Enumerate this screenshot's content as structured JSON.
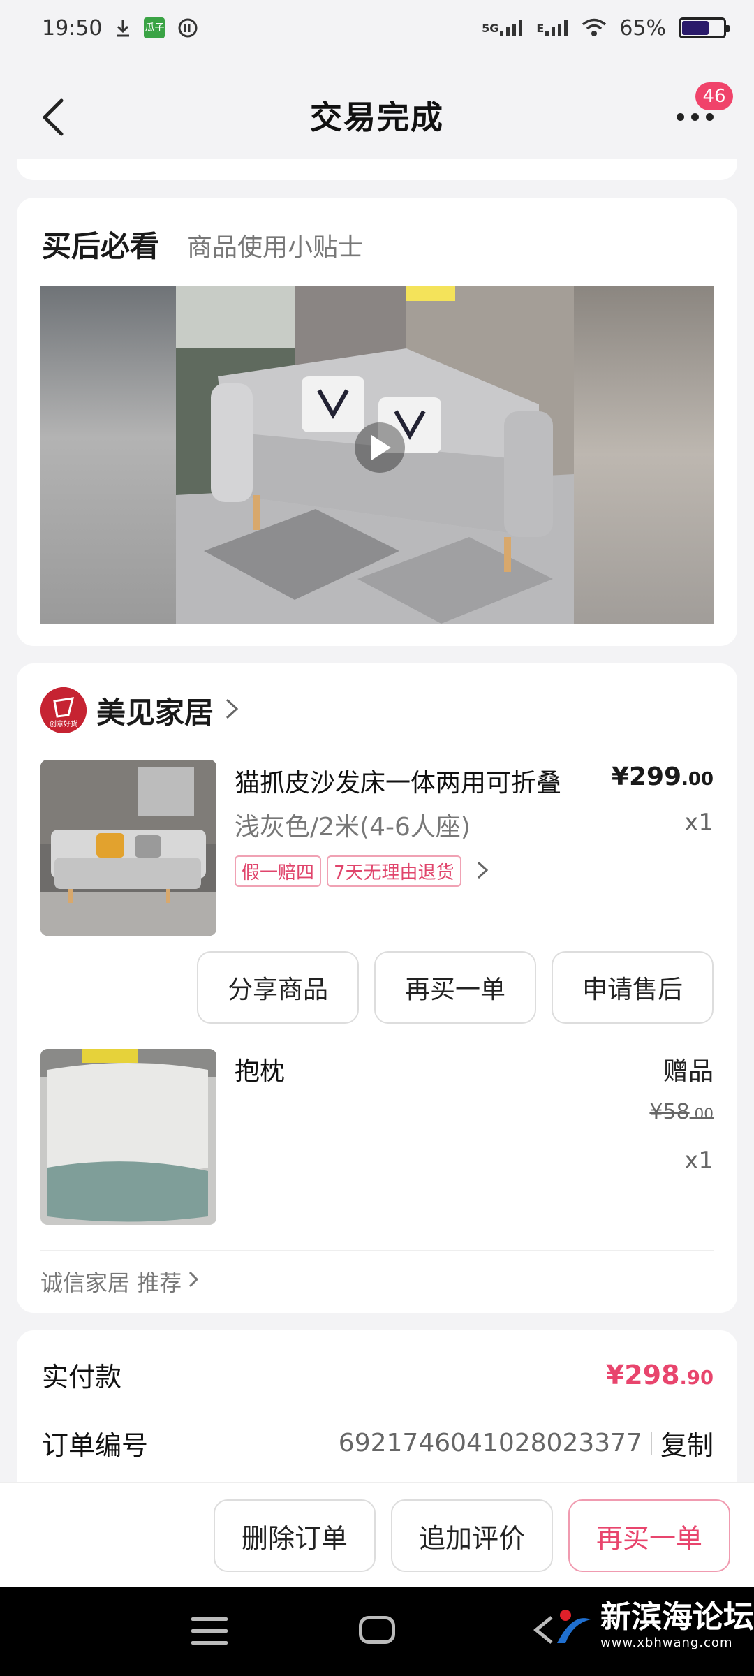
{
  "status_bar": {
    "time": "19:50",
    "app_icon_text": "瓜子",
    "network": "5G",
    "network2": "E",
    "battery": "65%",
    "battery_level": 0.65
  },
  "header": {
    "title": "交易完成",
    "badge": "46"
  },
  "tips": {
    "title": "买后必看",
    "subtitle": "商品使用小贴士"
  },
  "shop": {
    "logo_text": "创意好货",
    "name": "美见家居",
    "item1": {
      "title": "猫抓皮沙发床一体两用可折叠",
      "price_int": "¥299",
      "price_dec": ".00",
      "spec": "浅灰色/2米(4-6人座)",
      "qty": "x1",
      "tags": [
        "假一赔四",
        "7天无理由退货"
      ]
    },
    "item_buttons": [
      "分享商品",
      "再买一单",
      "申请售后"
    ],
    "item2": {
      "title": "抱枕",
      "gift_label": "赠品",
      "price_int": "¥58",
      "price_dec": ".00",
      "qty": "x1"
    },
    "recommend": "诚信家居 推荐"
  },
  "payment": {
    "paid_label": "实付款",
    "paid_int": "¥298",
    "paid_dec": ".90",
    "order_label": "订单编号",
    "order_no": "6921746041028023377",
    "copy": "复制"
  },
  "bottom_actions": {
    "delete": "删除订单",
    "review": "追加评价",
    "rebuy": "再买一单"
  },
  "watermark": {
    "name": "新滨海论坛",
    "url": "www.xbhwang.com"
  }
}
